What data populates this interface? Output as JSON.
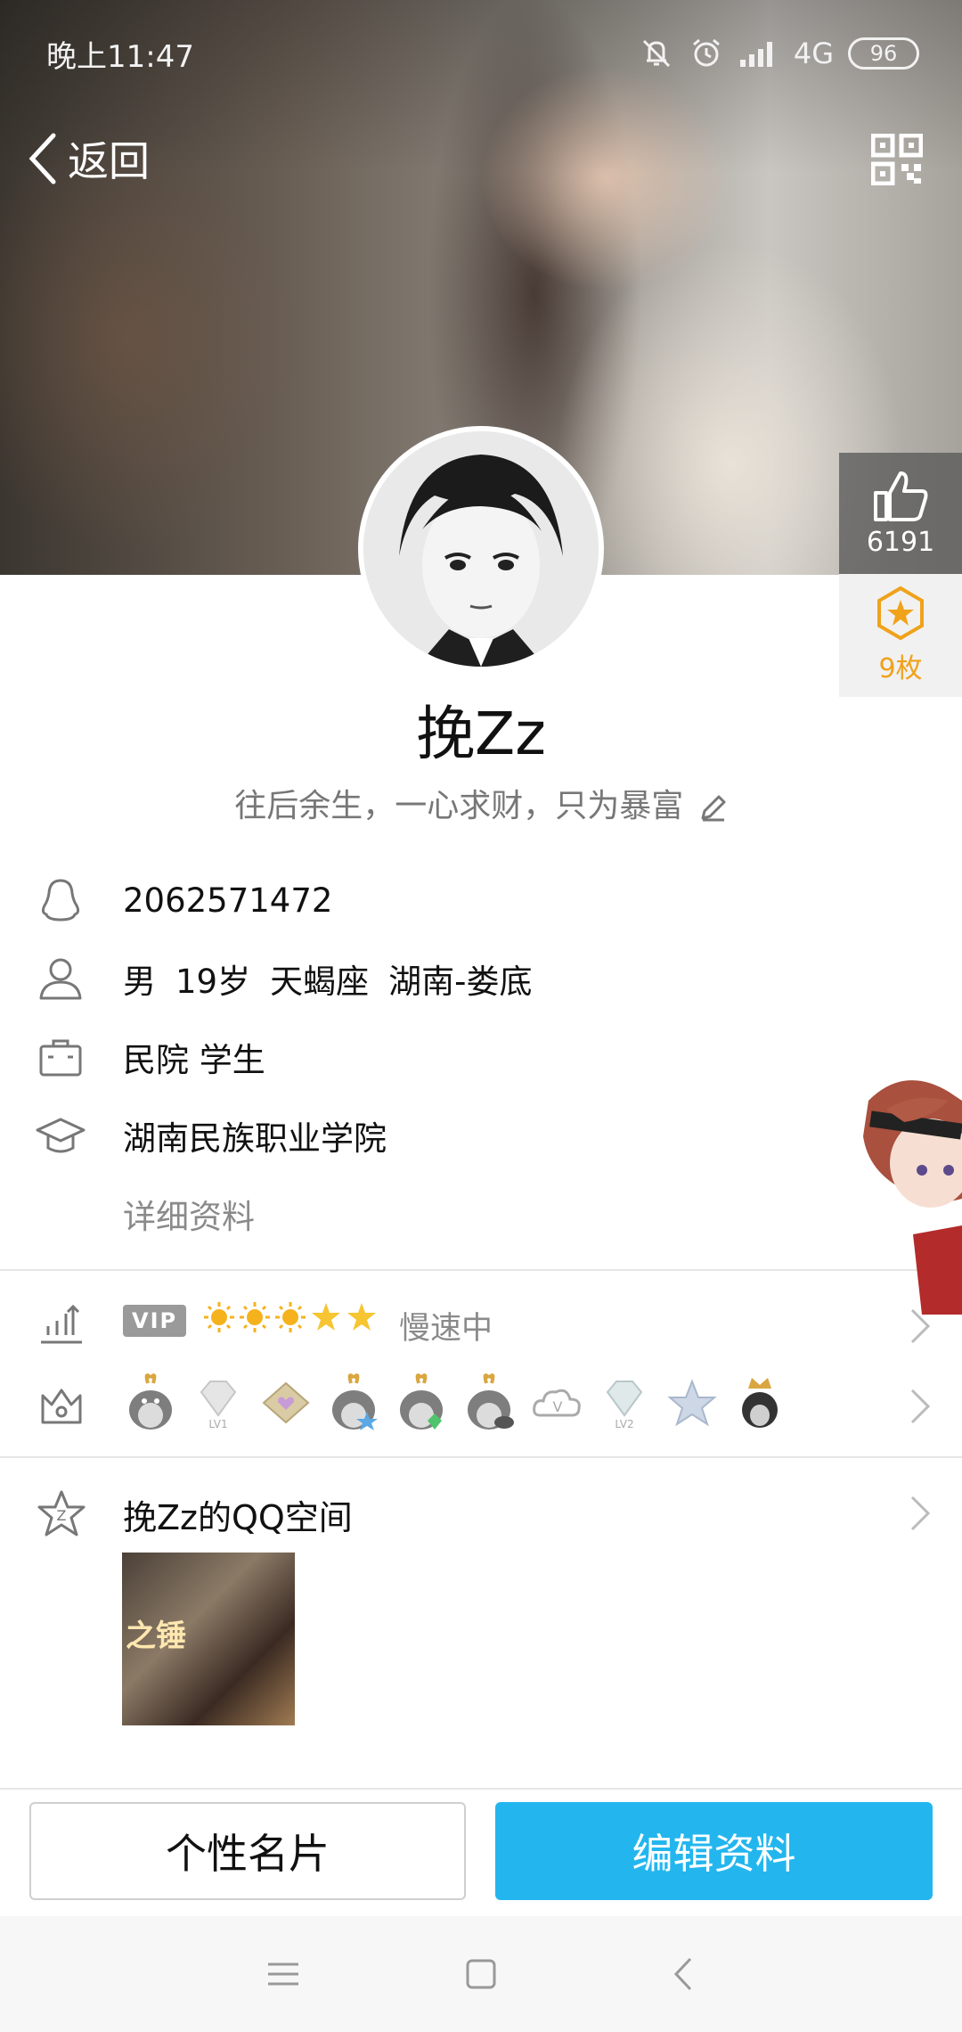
{
  "status_bar": {
    "time": "晚上11:47",
    "network": "4G",
    "battery": "96",
    "icons": [
      "mute-icon",
      "alarm-icon",
      "signal-icon"
    ]
  },
  "header": {
    "back_label": "返回",
    "qr_icon": "qr-code-icon"
  },
  "side": {
    "likes": "6191",
    "medals": "9枚"
  },
  "profile": {
    "nickname": "挽Zz",
    "signature": "往后余生，一心求财，只为暴富"
  },
  "info": {
    "qq": "2062571472",
    "gender": "男",
    "age": "19岁",
    "zodiac": "天蝎座",
    "location": "湖南-娄底",
    "job": "民院 学生",
    "school": "湖南民族职业学院",
    "details_link": "详细资料"
  },
  "vip": {
    "tag": "VIP",
    "status": "慢速中",
    "suns": 3,
    "stars": 2
  },
  "qzone": {
    "title": "挽Zz的QQ空间",
    "thumb_text": "之锤"
  },
  "buttons": {
    "card": "个性名片",
    "edit": "编辑资料"
  },
  "colors": {
    "accent": "#23b6ee",
    "medal": "#f0a21b",
    "muted": "#8a8a8a"
  }
}
